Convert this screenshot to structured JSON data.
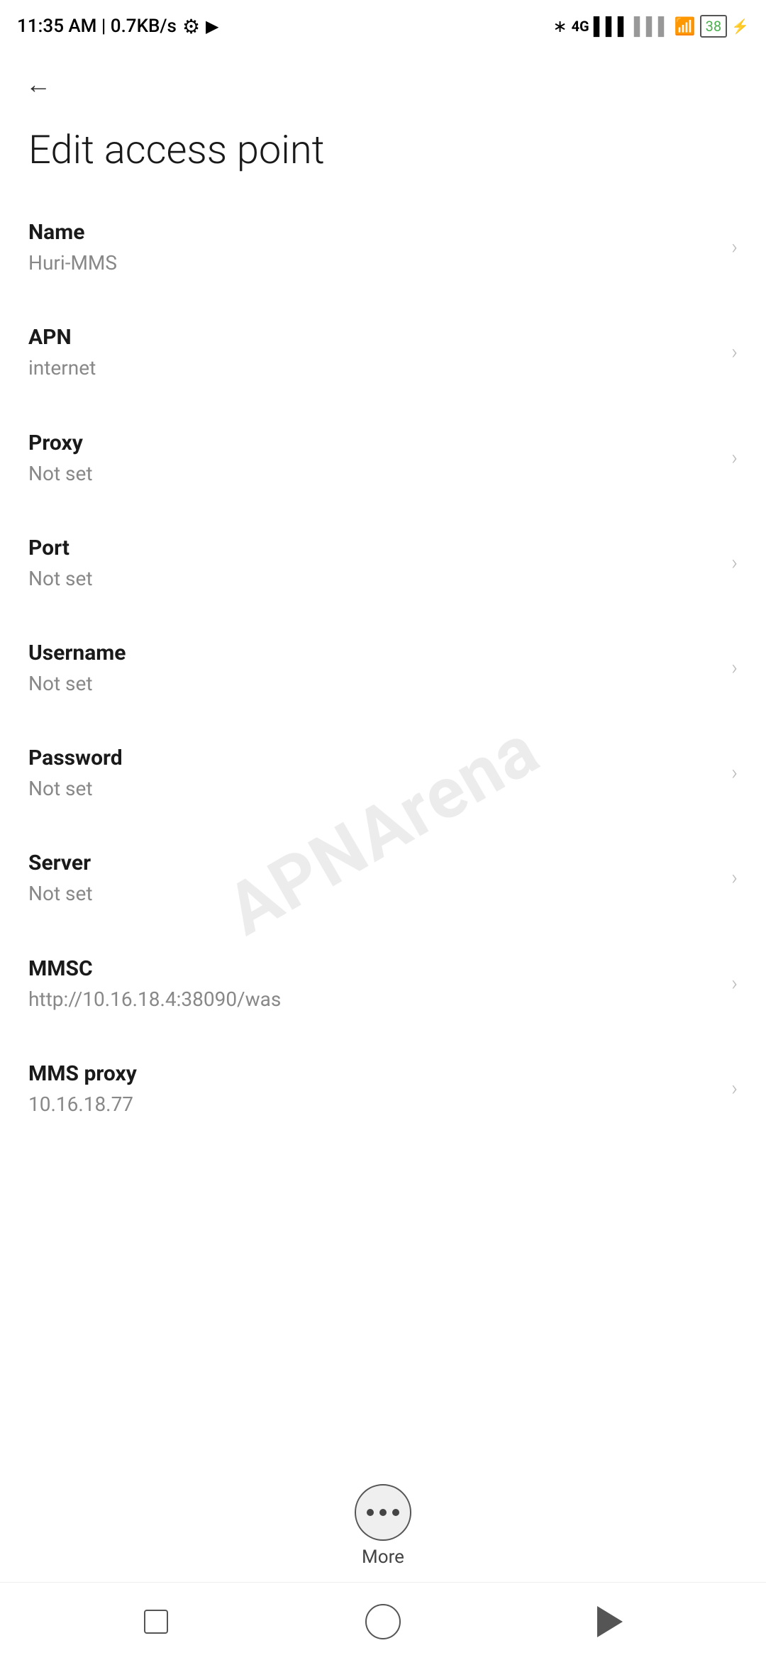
{
  "statusBar": {
    "time": "11:35 AM | 0.7KB/s",
    "icons": [
      "gear",
      "video",
      "bluetooth",
      "4g",
      "signal1",
      "signal2",
      "wifi",
      "battery"
    ]
  },
  "header": {
    "backLabel": "←",
    "title": "Edit access point"
  },
  "settings": {
    "items": [
      {
        "label": "Name",
        "value": "Huri-MMS"
      },
      {
        "label": "APN",
        "value": "internet"
      },
      {
        "label": "Proxy",
        "value": "Not set"
      },
      {
        "label": "Port",
        "value": "Not set"
      },
      {
        "label": "Username",
        "value": "Not set"
      },
      {
        "label": "Password",
        "value": "Not set"
      },
      {
        "label": "Server",
        "value": "Not set"
      },
      {
        "label": "MMSC",
        "value": "http://10.16.18.4:38090/was"
      },
      {
        "label": "MMS proxy",
        "value": "10.16.18.77"
      }
    ]
  },
  "moreButton": {
    "label": "More"
  },
  "navBar": {
    "squareLabel": "recent-apps",
    "circleLabel": "home",
    "triangleLabel": "back"
  }
}
